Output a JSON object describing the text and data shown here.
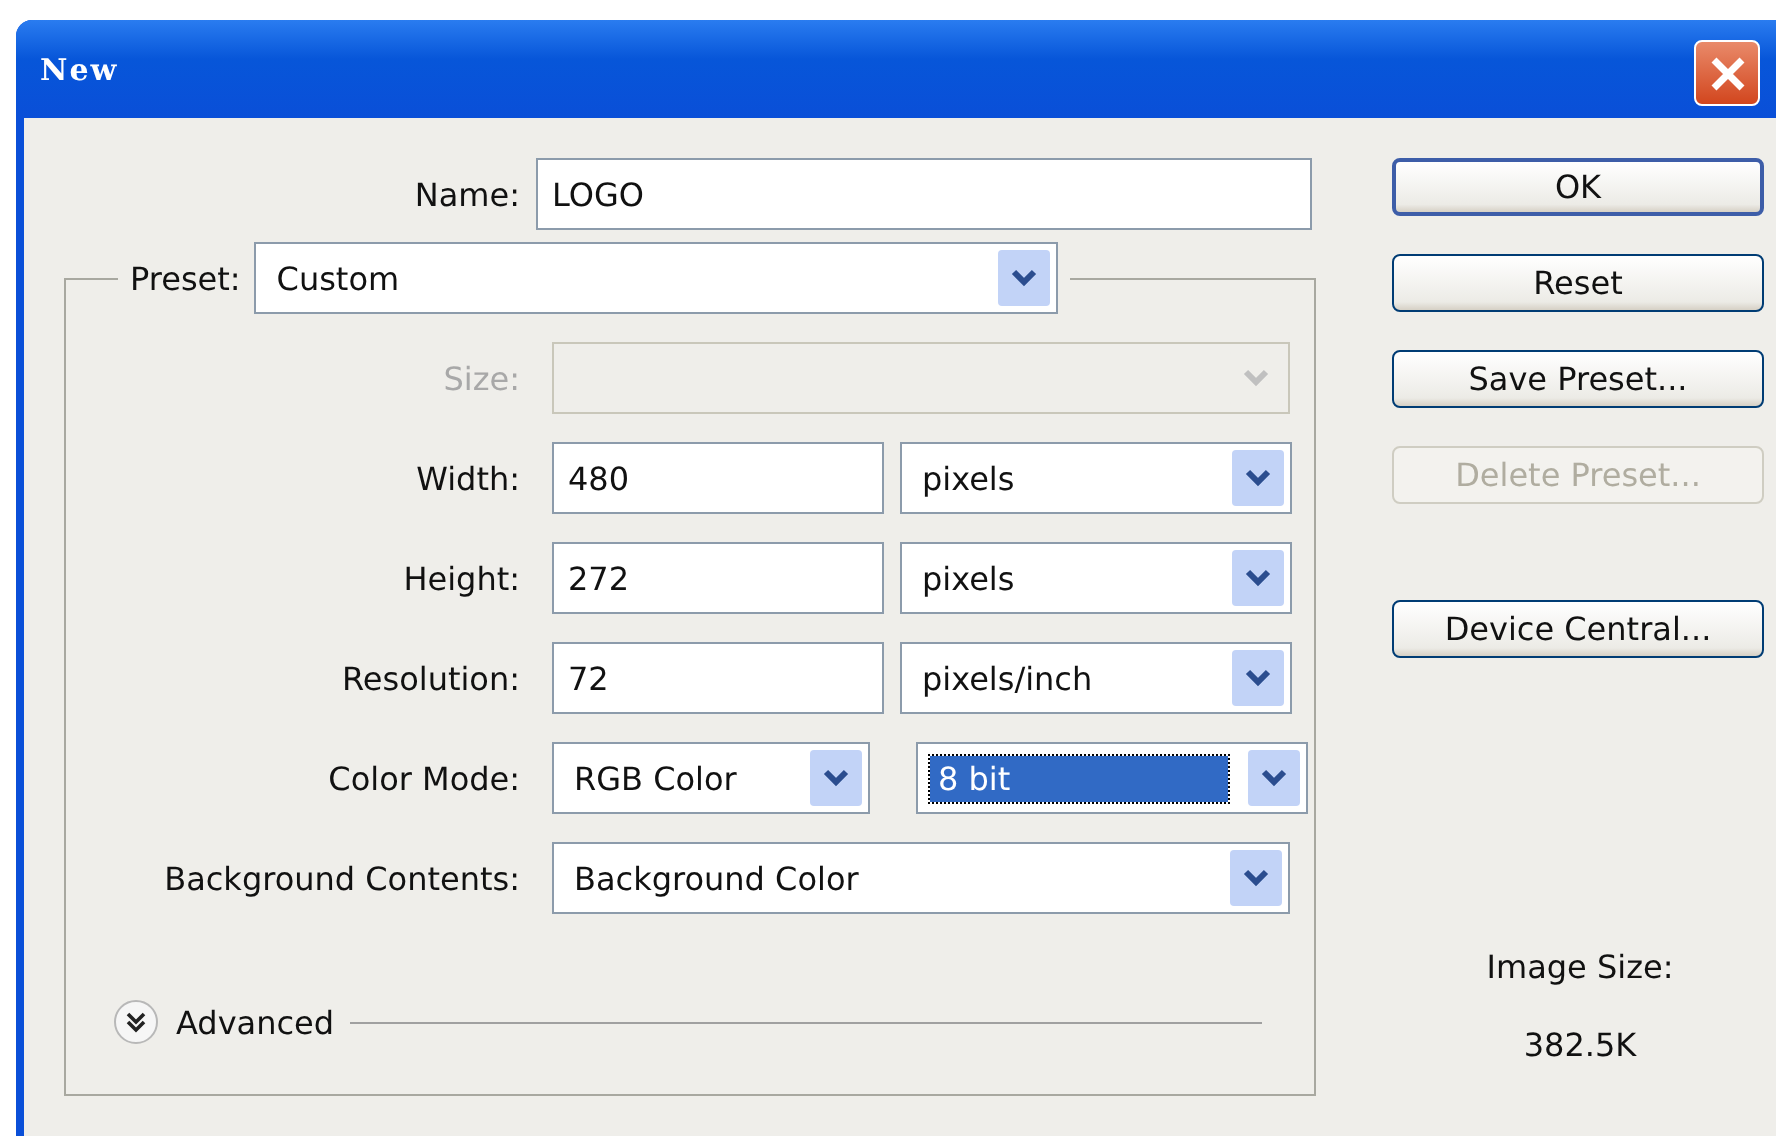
{
  "window": {
    "title": "New"
  },
  "name": {
    "label": "Name:",
    "value": "LOGO"
  },
  "preset": {
    "label": "Preset:",
    "value": "Custom"
  },
  "rows": [
    {
      "kind": "select",
      "label": "Size:",
      "disabled": true
    },
    {
      "kind": "number",
      "label": "Width:",
      "value": "480",
      "unit": {
        "value": "pixels",
        "highlighted": false
      },
      "disabled": false
    },
    {
      "kind": "number",
      "label": "Height:",
      "value": "272",
      "unit": {
        "value": "pixels",
        "highlighted": false
      },
      "disabled": false
    },
    {
      "kind": "number",
      "label": "Resolution:",
      "value": "72",
      "unit": {
        "value": "pixels/inch",
        "highlighted": false
      },
      "disabled": false
    },
    {
      "kind": "mode",
      "label": "Color Mode:",
      "value": "RGB Color",
      "unit": {
        "value": "8 bit",
        "highlighted": true
      },
      "disabled": false
    },
    {
      "kind": "select",
      "label": "Background Contents:",
      "value": "Background Color",
      "disabled": false
    }
  ],
  "advanced": {
    "label": "Advanced",
    "expanded": false
  },
  "buttons": [
    {
      "label": "OK",
      "default": true,
      "disabled": false
    },
    {
      "label": "Reset",
      "default": false,
      "disabled": false
    },
    {
      "label": "Save Preset...",
      "default": false,
      "disabled": false
    },
    {
      "label": "Delete Preset...",
      "default": false,
      "disabled": true
    },
    {
      "label": "Device Central...",
      "default": false,
      "disabled": false
    }
  ],
  "image_size": {
    "label": "Image Size:",
    "value": "382.5K"
  }
}
